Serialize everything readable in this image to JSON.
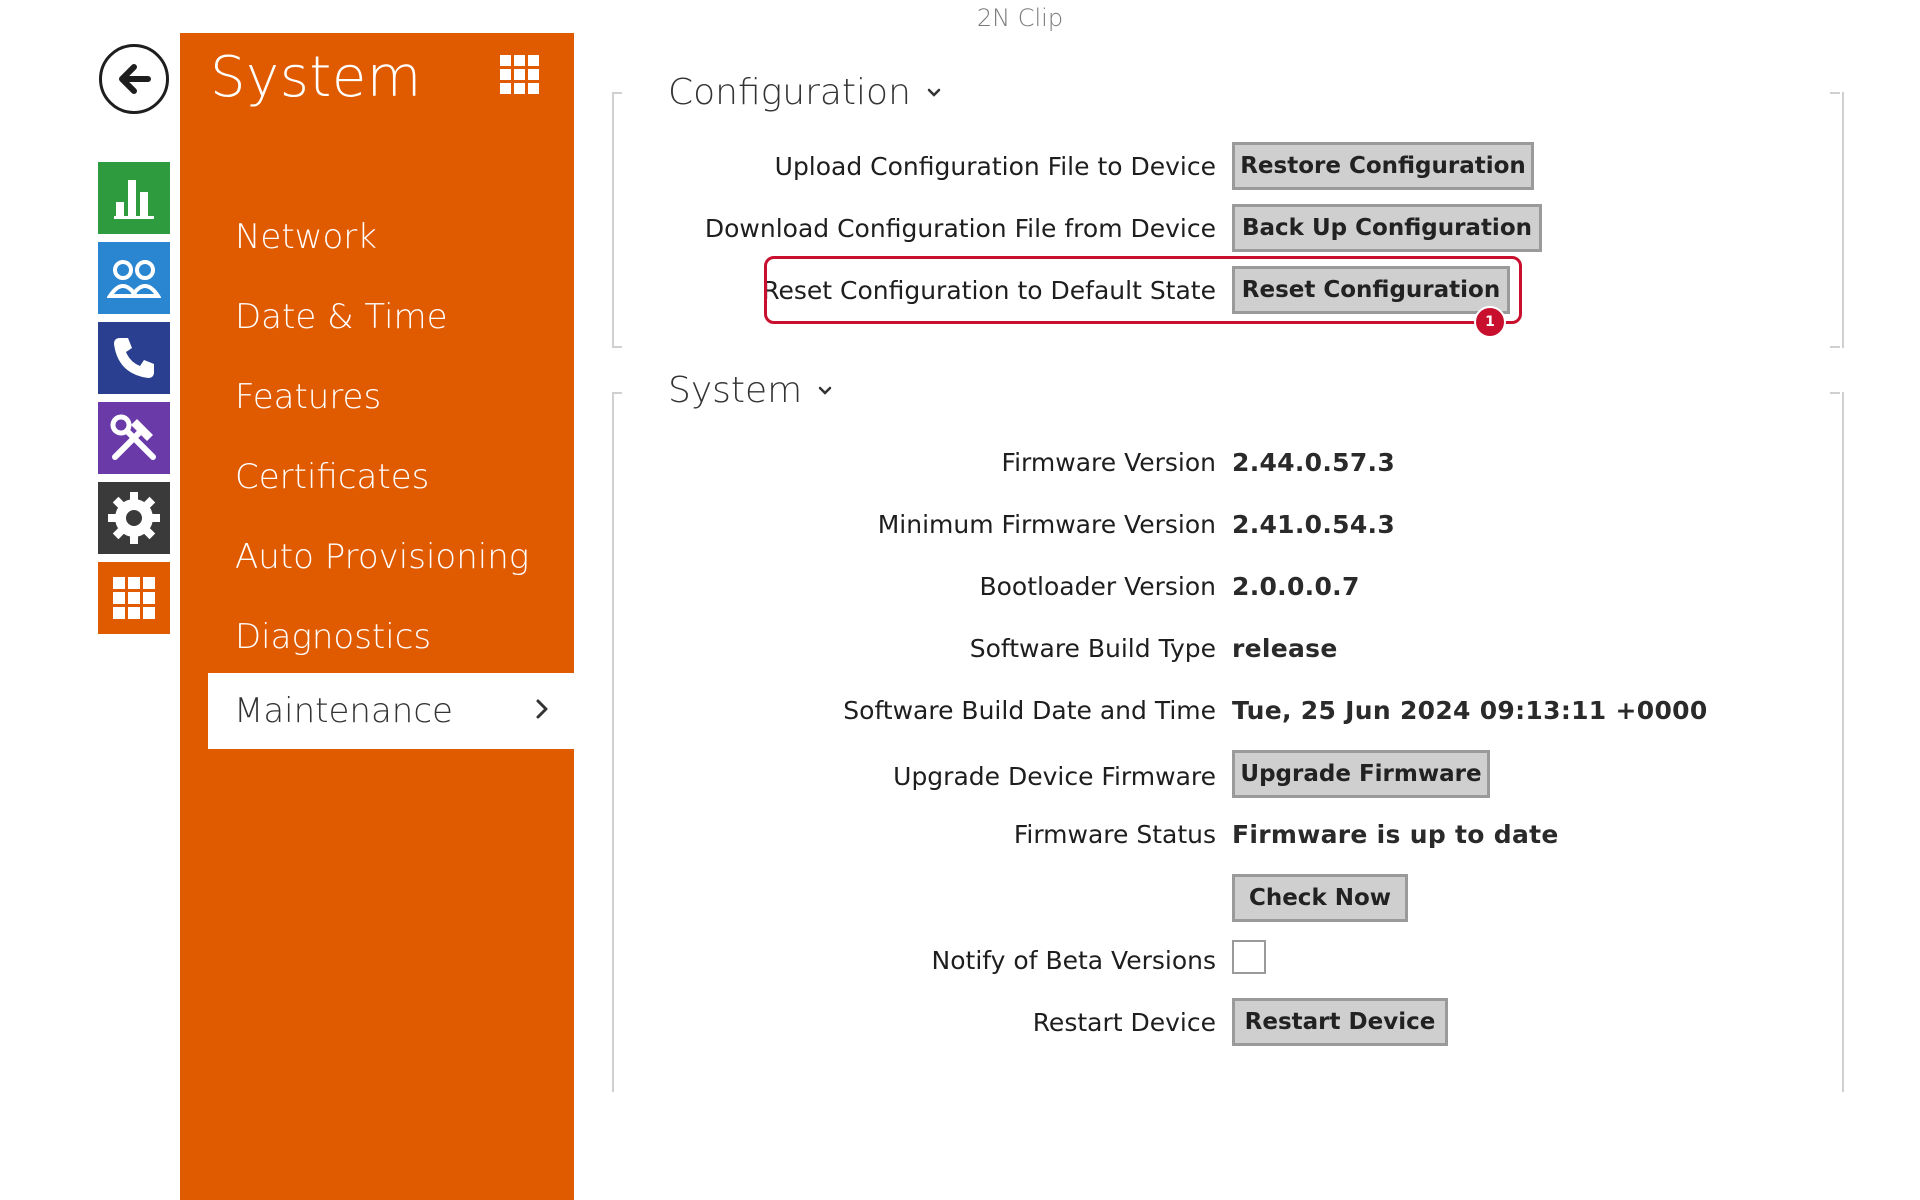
{
  "device_title": "2N Clip",
  "rail": {
    "back_icon": "back-arrow-icon",
    "tiles": [
      {
        "name": "status",
        "icon": "bar-chart-icon",
        "color": "#2e9b3e"
      },
      {
        "name": "directory",
        "icon": "users-icon",
        "color": "#2a86d1"
      },
      {
        "name": "calls",
        "icon": "phone-icon",
        "color": "#2a3f8f"
      },
      {
        "name": "hardware",
        "icon": "tools-icon",
        "color": "#6a3aa8"
      },
      {
        "name": "services",
        "icon": "gear-icon",
        "color": "#3a3a3a"
      },
      {
        "name": "system",
        "icon": "grid-icon",
        "color": "#e05a00"
      }
    ]
  },
  "sidebar": {
    "title": "System",
    "color": "#e05a00",
    "items": [
      {
        "label": "Network"
      },
      {
        "label": "Date & Time"
      },
      {
        "label": "Features"
      },
      {
        "label": "Certificates"
      },
      {
        "label": "Auto Provisioning"
      },
      {
        "label": "Diagnostics"
      },
      {
        "label": "Maintenance",
        "active": true
      }
    ]
  },
  "configuration": {
    "heading": "Configuration",
    "rows": [
      {
        "label": "Upload Configuration File to Device",
        "button": "Restore Configuration"
      },
      {
        "label": "Download Configuration File from Device",
        "button": "Back Up Configuration"
      },
      {
        "label": "Reset Configuration to Default State",
        "button": "Reset Configuration"
      }
    ],
    "highlight_badge": "1",
    "highlight_color": "#c8102e"
  },
  "system": {
    "heading": "System",
    "firmware_version_label": "Firmware Version",
    "firmware_version": "2.44.0.57.3",
    "min_firmware_label": "Minimum Firmware Version",
    "min_firmware": "2.41.0.54.3",
    "bootloader_label": "Bootloader Version",
    "bootloader": "2.0.0.0.7",
    "build_type_label": "Software Build Type",
    "build_type": "release",
    "build_date_label": "Software Build Date and Time",
    "build_date": "Tue, 25 Jun 2024 09:13:11 +0000",
    "upgrade_label": "Upgrade Device Firmware",
    "upgrade_button": "Upgrade Firmware",
    "status_label": "Firmware Status",
    "status": "Firmware is up to date",
    "check_button": "Check Now",
    "beta_label": "Notify of Beta Versions",
    "beta_checked": false,
    "restart_label": "Restart Device",
    "restart_button": "Restart Device"
  }
}
